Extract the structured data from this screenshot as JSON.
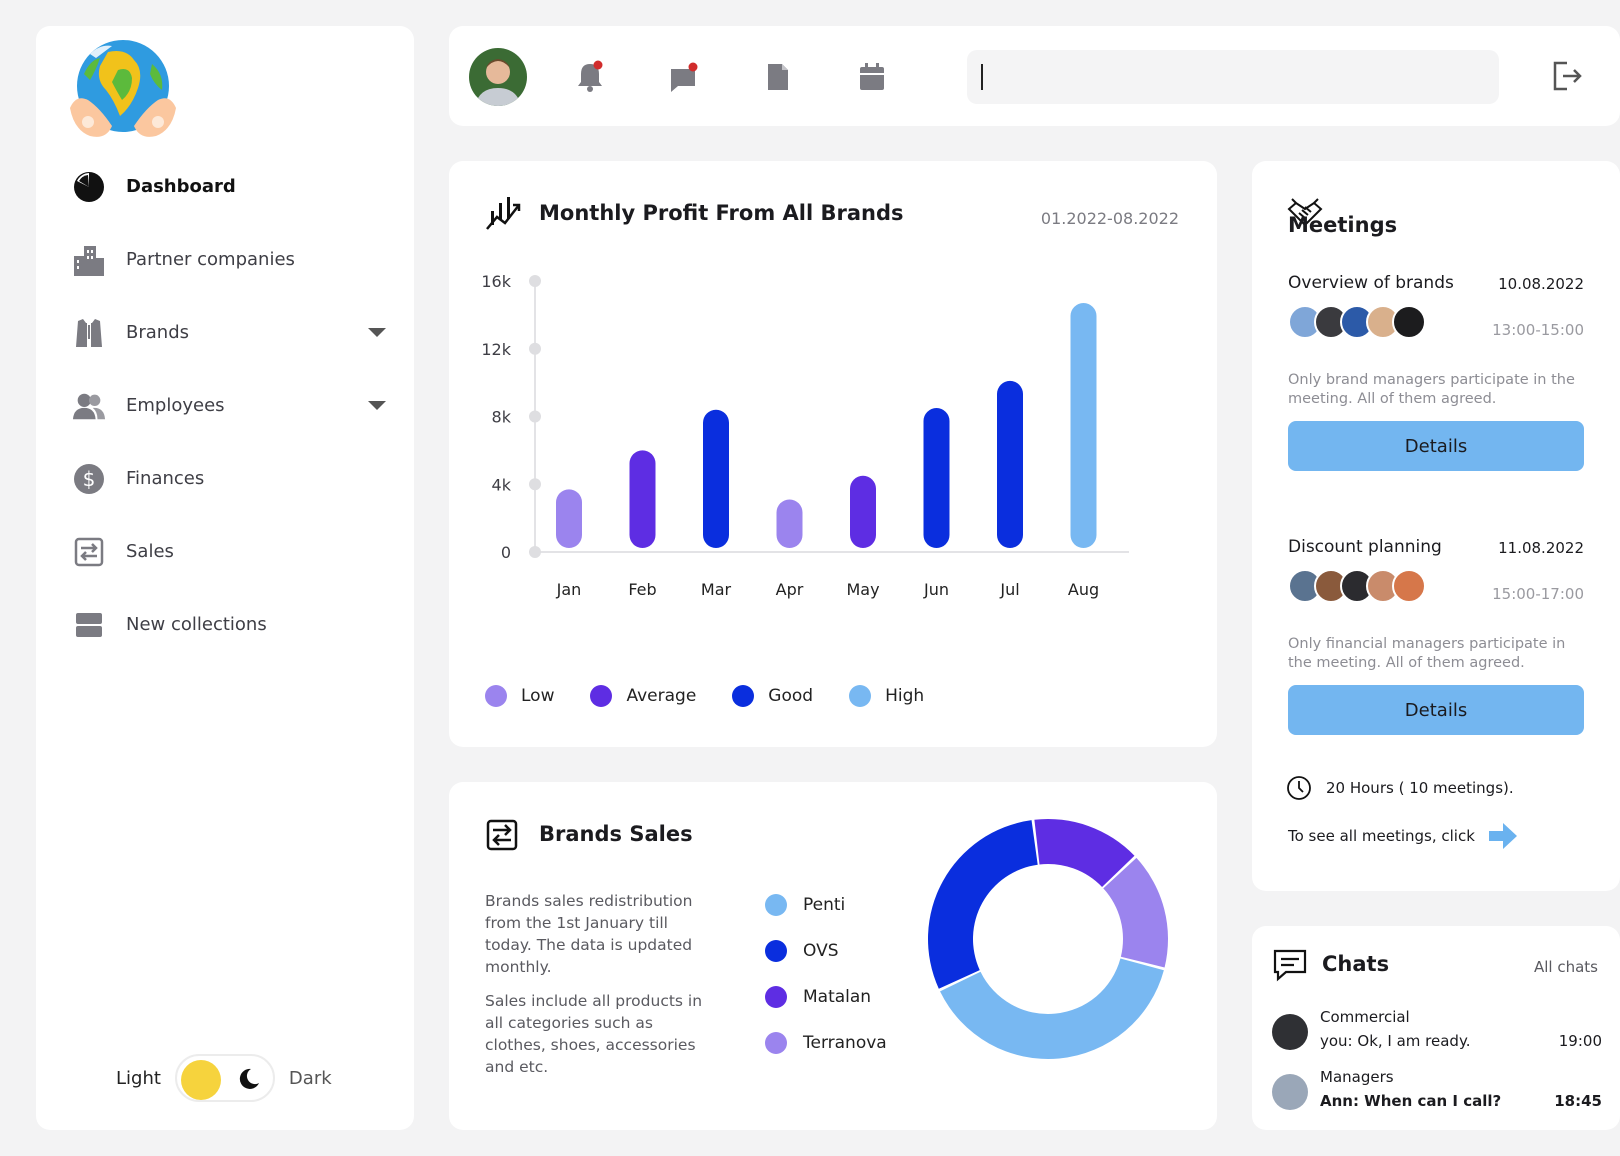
{
  "sidebar": {
    "items": [
      {
        "label": "Dashboard",
        "icon": "pie-chart-icon"
      },
      {
        "label": "Partner companies",
        "icon": "buildings-icon"
      },
      {
        "label": "Brands",
        "icon": "shirt-icon"
      },
      {
        "label": "Employees",
        "icon": "users-icon"
      },
      {
        "label": "Finances",
        "icon": "dollar-icon"
      },
      {
        "label": "Sales",
        "icon": "exchange-icon"
      },
      {
        "label": "New collections",
        "icon": "collection-icon"
      }
    ],
    "theme": {
      "light_label": "Light",
      "dark_label": "Dark"
    }
  },
  "header": {
    "search_value": ""
  },
  "profit": {
    "title": "Monthly Profit From All Brands",
    "date_range": "01.2022-08.2022"
  },
  "chart_data": {
    "type": "bar",
    "title": "Monthly Profit From All Brands",
    "categories": [
      "Jan",
      "Feb",
      "Mar",
      "Apr",
      "May",
      "Jun",
      "Jul",
      "Aug"
    ],
    "values": [
      3700,
      6000,
      8400,
      3100,
      4500,
      8500,
      10100,
      14700
    ],
    "value_levels": [
      "Low",
      "Average",
      "Good",
      "Low",
      "Average",
      "Good",
      "Good",
      "High"
    ],
    "y_ticks": [
      "16k",
      "12k",
      "8k",
      "4k",
      "0"
    ],
    "ylim": [
      0,
      16000
    ],
    "legend": [
      {
        "label": "Low",
        "color": "#9b84ee"
      },
      {
        "label": "Average",
        "color": "#5e2de3"
      },
      {
        "label": "Good",
        "color": "#0a2ede"
      },
      {
        "label": "High",
        "color": "#78b8f2"
      }
    ],
    "colors": {
      "Low": "#9b84ee",
      "Average": "#5e2de3",
      "Good": "#0a2ede",
      "High": "#78b8f2"
    }
  },
  "sales": {
    "title": "Brands Sales",
    "para1": "Brands sales redistribution from the 1st January till today. The data is updated monthly.",
    "para2": "Sales include all products in all categories such as clothes, shoes, accessories and etc.",
    "legend": [
      {
        "label": "Penti",
        "color": "#78b8f2"
      },
      {
        "label": "OVS",
        "color": "#0a2ede"
      },
      {
        "label": "Matalan",
        "color": "#5e2de3"
      },
      {
        "label": "Terranova",
        "color": "#9b84ee"
      }
    ],
    "donut": [
      {
        "label": "Penti",
        "value": 39,
        "color": "#78b8f2"
      },
      {
        "label": "OVS",
        "value": 30,
        "color": "#0a2ede"
      },
      {
        "label": "Matalan",
        "value": 15,
        "color": "#5e2de3"
      },
      {
        "label": "Terranova",
        "value": 16,
        "color": "#9b84ee"
      }
    ]
  },
  "meetings": {
    "title": "Meetings",
    "list": [
      {
        "name": "Overview of brands",
        "date": "10.08.2022",
        "time": "13:00-15:00",
        "note": "Only brand managers participate in the meeting. All of them agreed.",
        "button": "Details"
      },
      {
        "name": "Discount planning",
        "date": "11.08.2022",
        "time": "15:00-17:00",
        "note": "Only financial managers participate in the meeting. All of them agreed.",
        "button": "Details"
      }
    ],
    "summary": "20 Hours ( 10 meetings).",
    "see_all": "To see all meetings, click"
  },
  "chats": {
    "title": "Chats",
    "all_label": "All chats",
    "list": [
      {
        "name": "Commercial",
        "message": "you: Ok, I am ready.",
        "time": "19:00",
        "unread": false
      },
      {
        "name": "Managers",
        "message": "Ann: When can I call?",
        "time": "18:45",
        "unread": true
      }
    ]
  }
}
